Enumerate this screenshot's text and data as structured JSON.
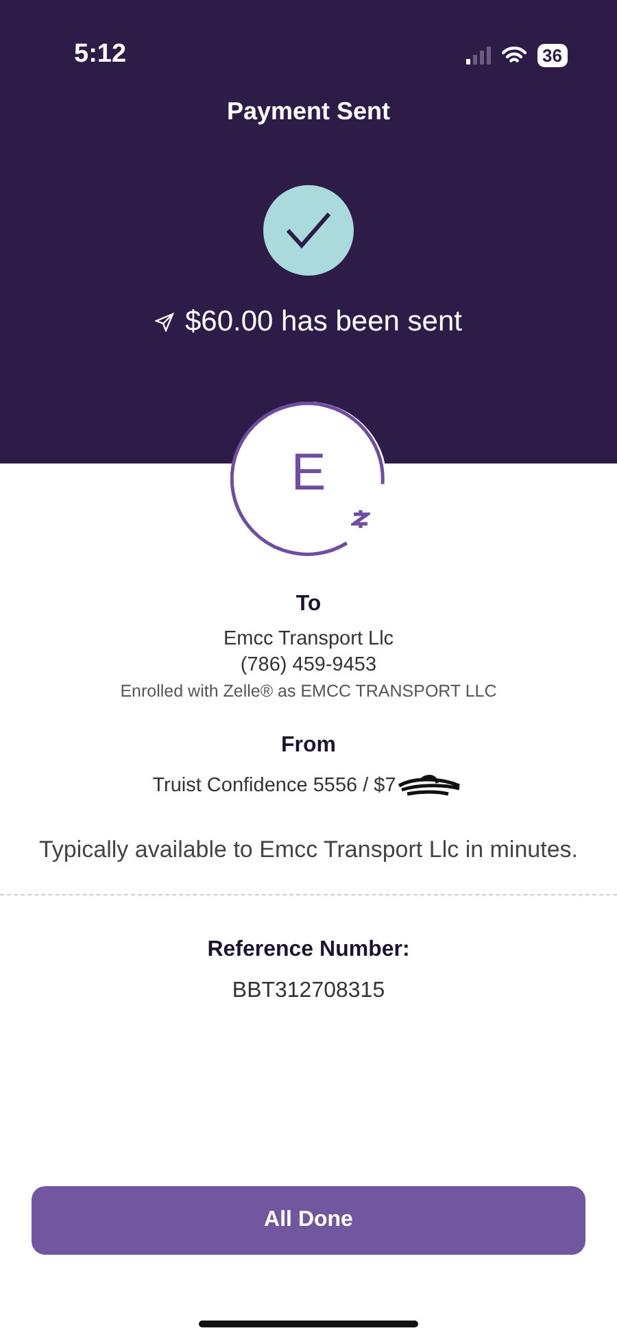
{
  "status_bar": {
    "time": "5:12",
    "battery": "36"
  },
  "header": {
    "title": "Payment Sent",
    "message": "$60.00 has been sent"
  },
  "recipient": {
    "initial": "E",
    "heading": "To",
    "name": "Emcc Transport Llc",
    "phone": "(786) 459-9453",
    "enrolled": "Enrolled with Zelle® as EMCC TRANSPORT LLC"
  },
  "sender": {
    "heading": "From",
    "account": "Truist Confidence 5556 / $7"
  },
  "availability": "Typically available to Emcc Transport Llc in minutes.",
  "reference": {
    "label": "Reference Number:",
    "number": "BBT312708315"
  },
  "buttons": [
    "All Done"
  ]
}
